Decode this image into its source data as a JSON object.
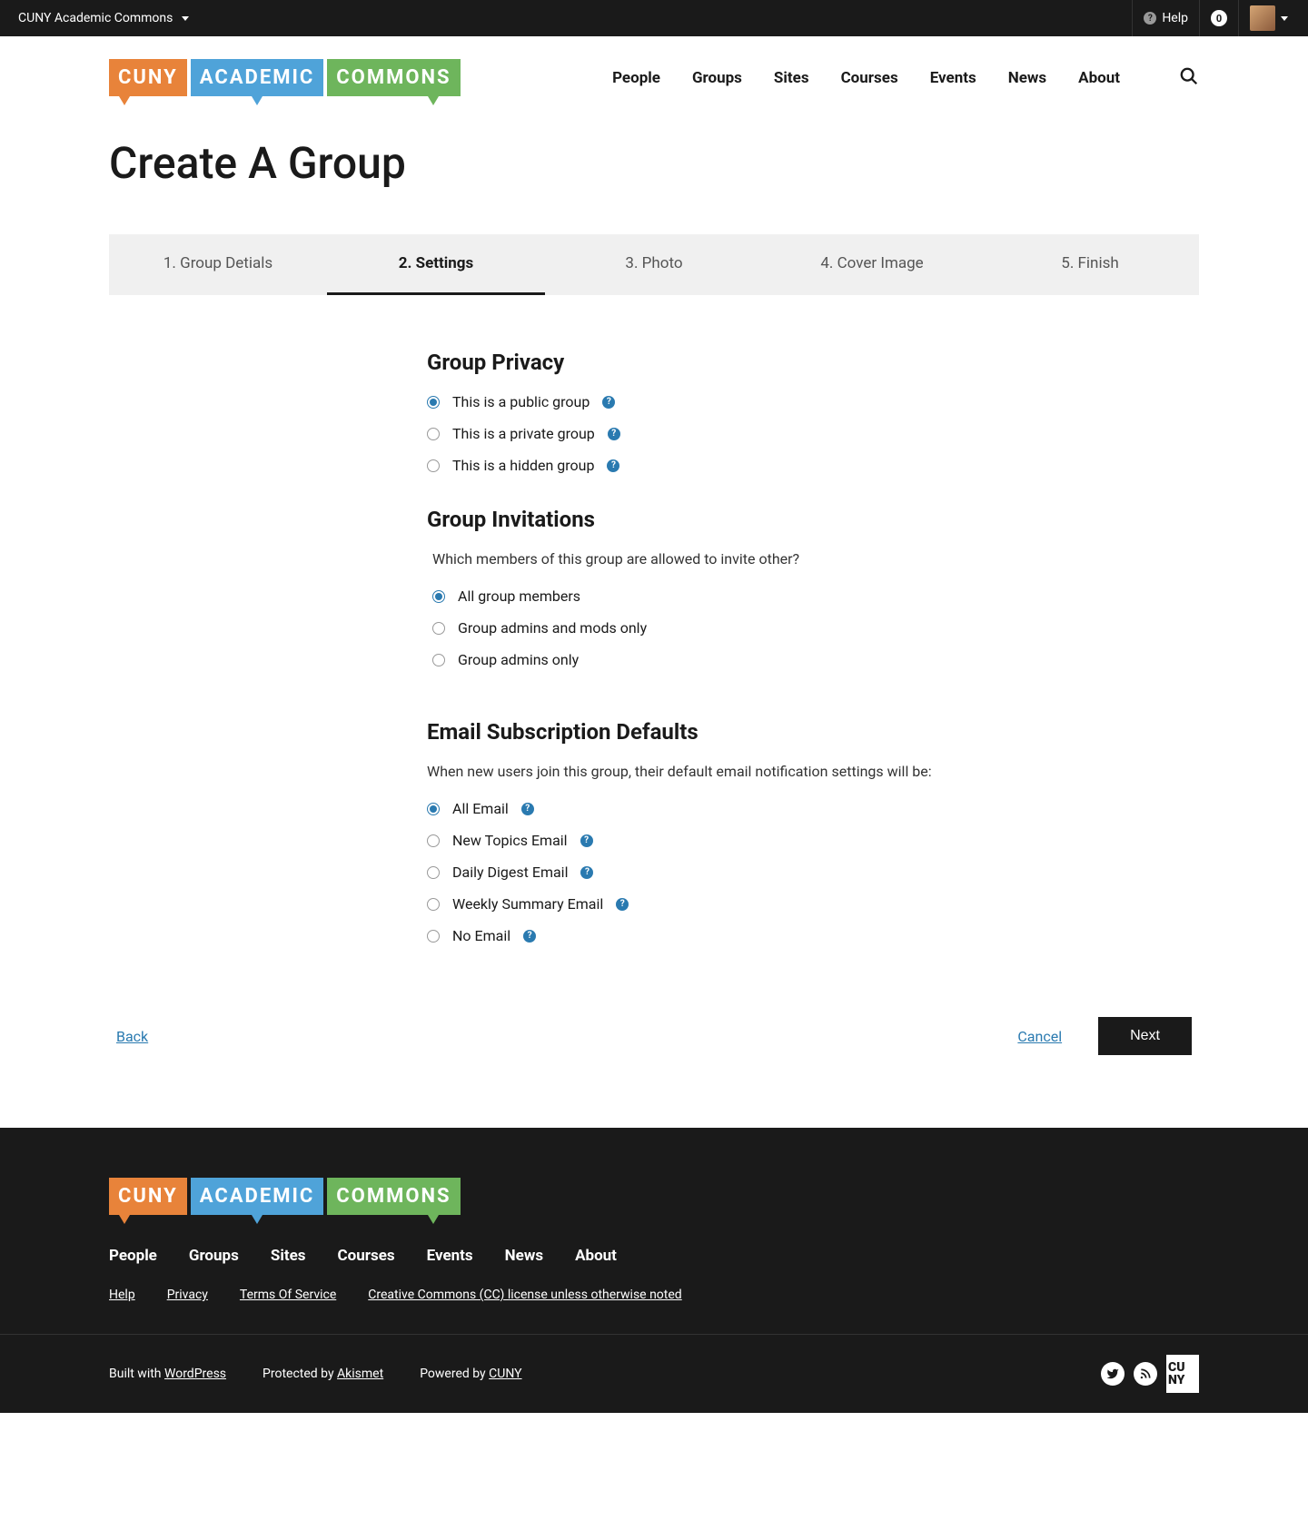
{
  "topbar": {
    "title": "CUNY Academic Commons",
    "help": "Help",
    "notif_count": "0"
  },
  "logo": {
    "w1": "CUNY",
    "w2": "ACADEMIC",
    "w3": "COMMONS"
  },
  "nav": {
    "people": "People",
    "groups": "Groups",
    "sites": "Sites",
    "courses": "Courses",
    "events": "Events",
    "news": "News",
    "about": "About"
  },
  "page_title": "Create A Group",
  "steps": {
    "s1": "1. Group Detials",
    "s2": "2. Settings",
    "s3": "3. Photo",
    "s4": "4. Cover Image",
    "s5": "5. Finish"
  },
  "privacy": {
    "title": "Group Privacy",
    "public": "This is a public group",
    "private": "This is a private group",
    "hidden": "This is a hidden group"
  },
  "invitations": {
    "title": "Group Invitations",
    "question": "Which members of this group are allowed to invite other?",
    "all": "All group members",
    "mods": "Group admins and mods only",
    "admins": "Group admins only"
  },
  "email": {
    "title": "Email Subscription Defaults",
    "desc": "When new users join this group, their default email notification settings will be:",
    "all": "All Email",
    "new_topics": "New Topics Email",
    "daily": "Daily Digest Email",
    "weekly": "Weekly Summary Email",
    "none": "No Email"
  },
  "actions": {
    "back": "Back",
    "cancel": "Cancel",
    "next": "Next"
  },
  "footer": {
    "nav": {
      "people": "People",
      "groups": "Groups",
      "sites": "Sites",
      "courses": "Courses",
      "events": "Events",
      "news": "News",
      "about": "About"
    },
    "legal": {
      "help": "Help",
      "privacy": "Privacy",
      "tos": "Terms Of Service",
      "cc": "Creative Commons (CC) license unless otherwise noted"
    },
    "built_pre": "Built with ",
    "built_link": "WordPress",
    "protected_pre": "Protected by ",
    "protected_link": "Akismet",
    "powered_pre": "Powered by ",
    "powered_link": "CUNY",
    "cuny_sq": "CU NY"
  }
}
